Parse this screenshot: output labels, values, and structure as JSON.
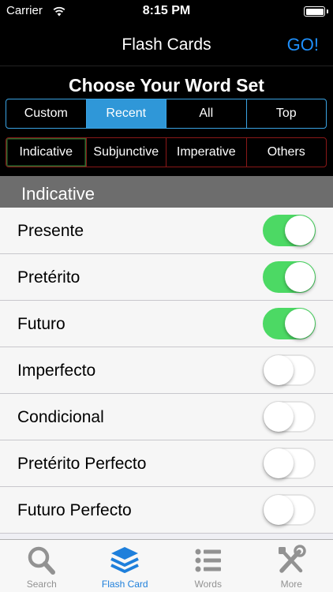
{
  "status": {
    "carrier": "Carrier",
    "time": "8:15 PM"
  },
  "nav": {
    "title": "Flash Cards",
    "go_label": "GO!"
  },
  "chooser": {
    "title": "Choose Your Word Set",
    "sets": [
      {
        "label": "Custom",
        "selected": false
      },
      {
        "label": "Recent",
        "selected": true
      },
      {
        "label": "All",
        "selected": false
      },
      {
        "label": "Top",
        "selected": false
      }
    ],
    "moods": [
      {
        "label": "Indicative"
      },
      {
        "label": "Subjunctive"
      },
      {
        "label": "Imperative"
      },
      {
        "label": "Others"
      }
    ]
  },
  "section": {
    "title": "Indicative"
  },
  "tenses": [
    {
      "label": "Presente",
      "on": true
    },
    {
      "label": "Pretérito",
      "on": true
    },
    {
      "label": "Futuro",
      "on": true
    },
    {
      "label": "Imperfecto",
      "on": false
    },
    {
      "label": "Condicional",
      "on": false
    },
    {
      "label": "Pretérito Perfecto",
      "on": false
    },
    {
      "label": "Futuro Perfecto",
      "on": false
    }
  ],
  "tabs": [
    {
      "label": "Search",
      "icon": "search-icon",
      "active": false
    },
    {
      "label": "Flash Card",
      "icon": "stack-icon",
      "active": true
    },
    {
      "label": "Words",
      "icon": "list-icon",
      "active": false
    },
    {
      "label": "More",
      "icon": "tools-icon",
      "active": false
    }
  ],
  "colors": {
    "accent": "#1e8ffb",
    "switch_on": "#4cd964",
    "segment_selected": "#2f97d8"
  }
}
